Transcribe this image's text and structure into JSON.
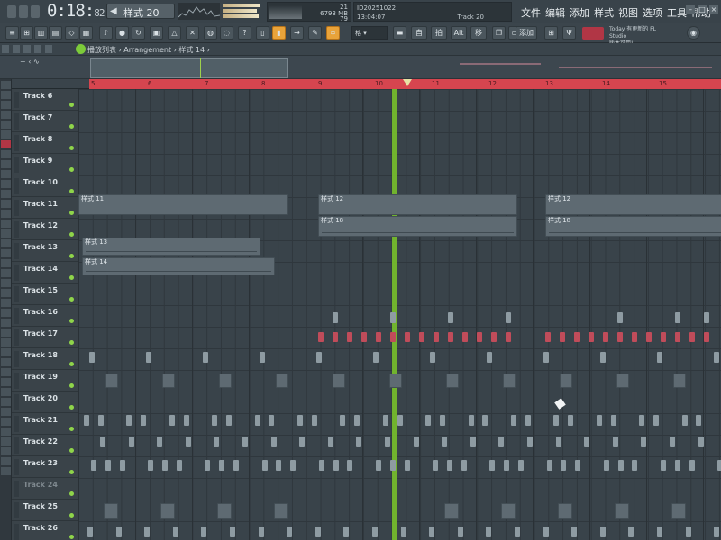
{
  "titlebar": {
    "time_main": "0:18:",
    "time_frac": "82",
    "pattern_label": "样式 20",
    "cpu_mem": "6793 MB",
    "cpu_value": "21",
    "cpu_poly": "79",
    "hint_line1": "ID20251022",
    "hint_line2": "13:04:07",
    "hint_track": "Track 20",
    "menu": [
      "文件",
      "编辑",
      "添加",
      "样式",
      "视图",
      "选项",
      "工具",
      "帮助"
    ],
    "news_line1": "Today 有更新的 FL Studio",
    "news_line2": "版本可用!"
  },
  "toolbar": {
    "snap_label": "格",
    "btn_labels": [
      "自",
      "拍",
      "Alt",
      "移",
      "添加"
    ]
  },
  "breadcrumb": {
    "text": "播放列表 › Arrangement › 样式 14 ›"
  },
  "ruler": {
    "numbers": [
      "5",
      "6",
      "7",
      "8",
      "9",
      "10",
      "11",
      "12",
      "13",
      "14",
      "15"
    ]
  },
  "tracks": [
    "Track 6",
    "Track 7",
    "Track 8",
    "Track 9",
    "Track 10",
    "Track 11",
    "Track 12",
    "Track 13",
    "Track 14",
    "Track 15",
    "Track 16",
    "Track 17",
    "Track 18",
    "Track 19",
    "Track 20",
    "Track 21",
    "Track 22",
    "Track 23",
    "Track 24",
    "Track 25",
    "Track 26"
  ],
  "clips": {
    "c11a": "样式 11",
    "c11b": "样式 12",
    "c11c": "样式 12",
    "c12a": "样式 18",
    "c12b": "样式 18",
    "c13": "样式 13",
    "c14": "样式 14"
  },
  "colors": {
    "accent": "#d6454f",
    "playhead": "#74b92c",
    "highlight": "#e9a33a"
  }
}
